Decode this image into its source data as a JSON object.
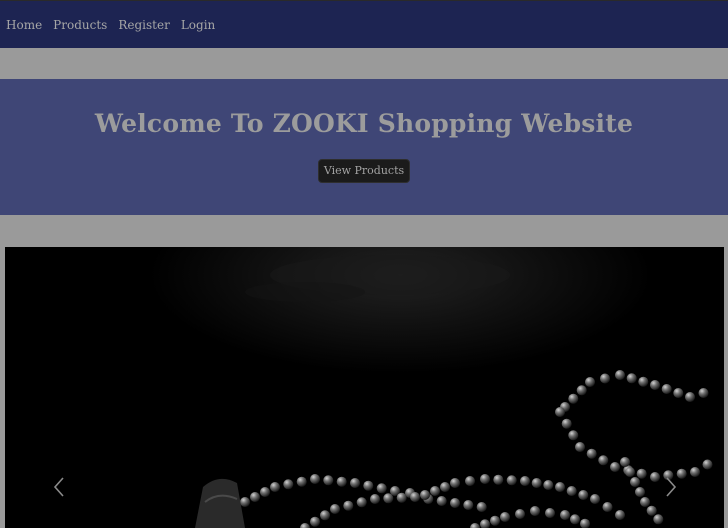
{
  "nav": {
    "items": [
      {
        "label": "Home"
      },
      {
        "label": "Products"
      },
      {
        "label": "Register"
      },
      {
        "label": "Login"
      }
    ]
  },
  "hero": {
    "title": "Welcome To ZOOKI Shopping Website",
    "button_label": "View Products"
  },
  "carousel": {
    "prev_icon": "chevron-left-icon",
    "next_icon": "chevron-right-icon",
    "image_subject": "beaded necklace on dark background"
  },
  "colors": {
    "navbar": "#1d2452",
    "hero": "#3f4676",
    "page_overlay": "#9a9a9a",
    "button": "#1b1b1b"
  }
}
